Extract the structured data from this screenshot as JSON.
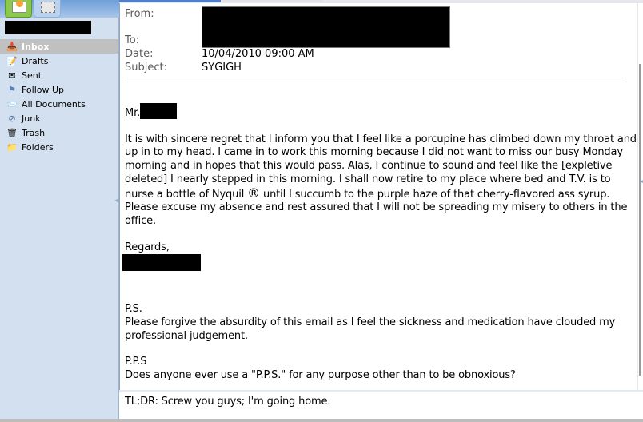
{
  "sidebar": {
    "app_tabs": [
      {
        "name": "mail",
        "icon": "mail-envelope-icon",
        "active": true
      },
      {
        "name": "documents",
        "icon": "documents-icon",
        "active": false
      }
    ],
    "account_name_redacted": true,
    "folders": [
      {
        "label": "Inbox",
        "icon": "inbox-icon",
        "glyph": "📥",
        "active": true
      },
      {
        "label": "Drafts",
        "icon": "drafts-icon",
        "glyph": "📝",
        "active": false
      },
      {
        "label": "Sent",
        "icon": "sent-icon",
        "glyph": "✉",
        "active": false
      },
      {
        "label": "Follow Up",
        "icon": "flag-icon",
        "glyph": "⚑",
        "active": false
      },
      {
        "label": "All Documents",
        "icon": "all-documents-icon",
        "glyph": "📨",
        "active": false
      },
      {
        "label": "Junk",
        "icon": "junk-icon",
        "glyph": "⊘",
        "active": false
      },
      {
        "label": "Trash",
        "icon": "trash-icon",
        "glyph": "🗑",
        "active": false
      },
      {
        "label": "Folders",
        "icon": "folders-icon",
        "glyph": "📁",
        "active": false
      }
    ],
    "colors": {
      "background": "#d3e0ef",
      "active_item": "#c0c0c0"
    }
  },
  "message": {
    "header": {
      "from_label": "From:",
      "to_label": "To:",
      "date_label": "Date:",
      "subject_label": "Subject:",
      "from_to_redacted": true,
      "date": "10/04/2010 09:00 AM",
      "subject": "SYGIGH"
    },
    "body": {
      "salutation": "Mr.",
      "paragraph_1": "It is with sincere regret that I inform you that I feel like a porcupine has climbed down my throat and up in to my head.  I came in to work this morning because I did not want to miss our busy Monday morning and in hopes that this would pass.  Alas, I continue to sound and feel like the [expletive deleted] I nearly stepped in this morning.  I shall now retire to my place where bed and T.V. is to nurse a bottle of Nyquil ",
      "registered_mark": "®",
      "paragraph_1_cont": " until I succumb to the purple haze of that cherry-flavored ass syrup.  Please excuse my absence and rest assured that I will not be spreading my misery to others in the office.",
      "closing": "Regards,",
      "ps_label": "P.S.",
      "ps_text": "Please forgive the absurdity of this email as I feel the sickness and medication have clouded my professional judgement.",
      "pps_label": "P.P.S",
      "pps_text": "Does anyone ever use a \"P.P.S.\" for any purpose other than to be obnoxious?",
      "tldr": "TL;DR: Screw you guys; I'm going home."
    }
  }
}
